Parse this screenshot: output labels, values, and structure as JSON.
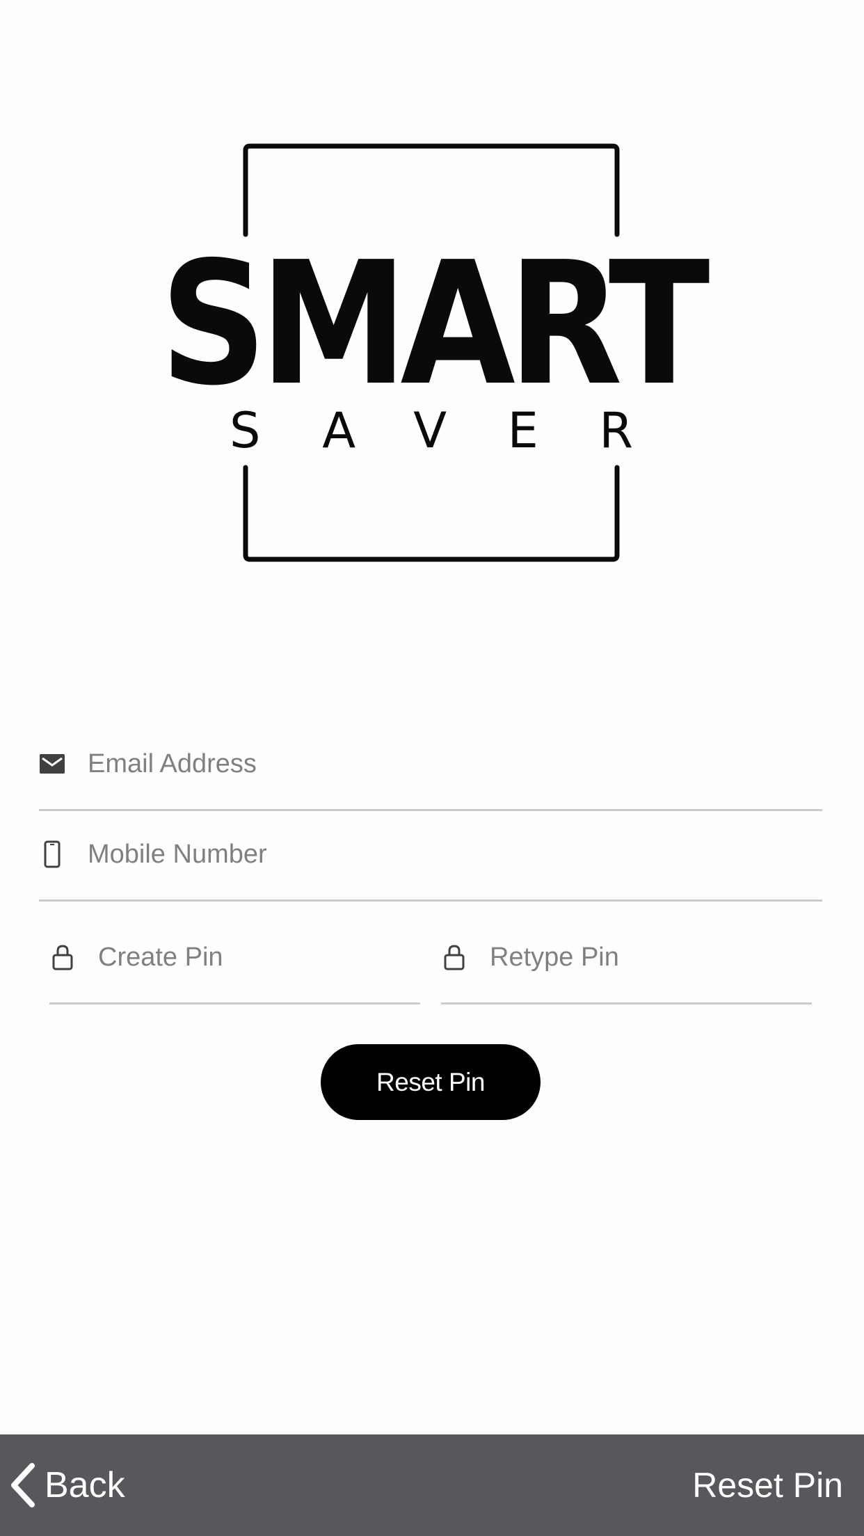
{
  "logo": {
    "title": "SMART",
    "subtitle": "SAVER"
  },
  "form": {
    "email": {
      "placeholder": "Email Address",
      "value": "",
      "icon": "envelope-icon"
    },
    "mobile": {
      "placeholder": "Mobile Number",
      "value": "",
      "icon": "phone-icon"
    },
    "create_pin": {
      "placeholder": "Create Pin",
      "value": "",
      "icon": "lock-icon"
    },
    "retype_pin": {
      "placeholder": "Retype Pin",
      "value": "",
      "icon": "lock-icon"
    },
    "submit_label": "Reset Pin"
  },
  "nav": {
    "back_label": "Back",
    "back_icon": "chevron-left-icon",
    "title": "Reset Pin"
  },
  "colors": {
    "background": "#fefefe",
    "button": "#000000",
    "button_text": "#ffffff",
    "bottom_bar": "#58585c",
    "placeholder": "#808080",
    "divider": "#cbcbcb"
  }
}
